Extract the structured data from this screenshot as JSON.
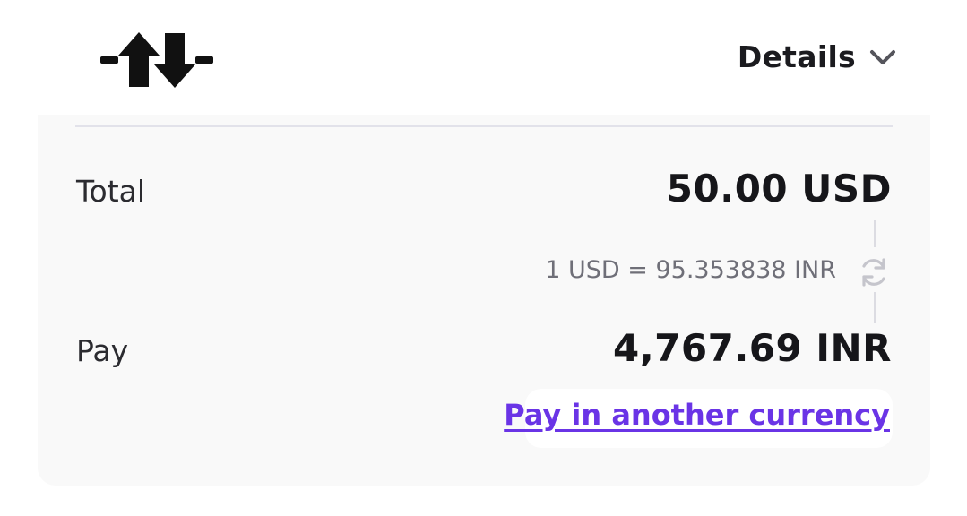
{
  "header": {
    "logo_icon": "transfer-arrows-icon",
    "details_label": "Details",
    "details_icon": "chevron-down-icon"
  },
  "summary": {
    "total_label": "Total",
    "total_amount": "50.00 USD",
    "exchange_rate": "1 USD = 95.353838 INR",
    "refresh_icon": "refresh-icon",
    "pay_label": "Pay",
    "pay_amount": "4,767.69 INR",
    "change_currency_link": "Pay in another currency"
  },
  "colors": {
    "accent": "#6a34e6",
    "card_background": "#f9f9f9",
    "muted_text": "#6f6f78"
  }
}
